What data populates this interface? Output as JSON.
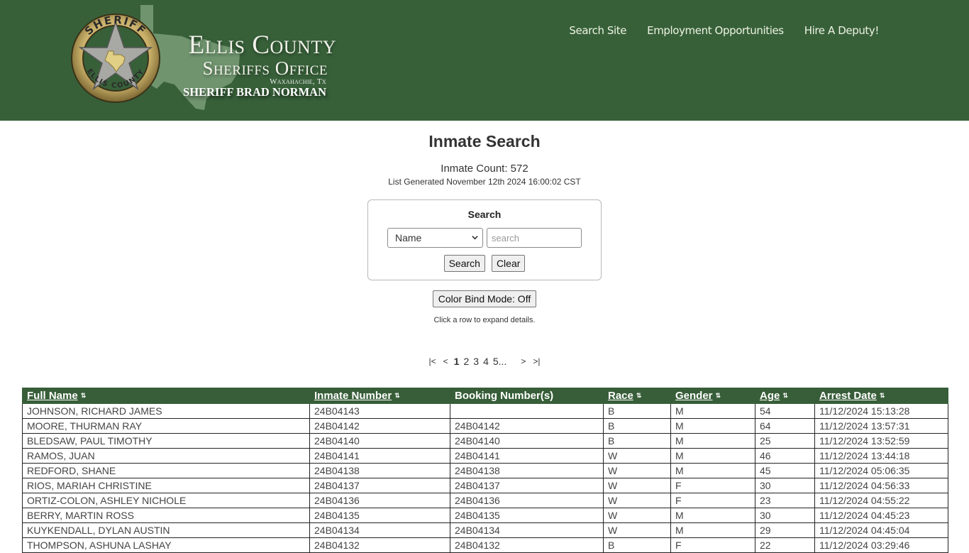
{
  "header": {
    "logo": {
      "badge_top_text": "SHERIFF",
      "badge_bottom_text": "ELLIS COUNTY",
      "line1": "Ellis County",
      "line2": "Sheriffs Office",
      "line3": "Waxahachie, Tx",
      "line4": "SHERIFF BRAD NORMAN"
    },
    "nav": [
      {
        "label": "Search Site"
      },
      {
        "label": "Employment Opportunities"
      },
      {
        "label": "Hire A Deputy!"
      }
    ],
    "colors": {
      "background": "#376039",
      "table_header": "#375e38"
    }
  },
  "main": {
    "title": "Inmate Search",
    "count_text": "Inmate Count: 572",
    "generated_text": "List Generated November 12th 2024 16:00:02 CST",
    "search": {
      "title": "Search",
      "field_selected": "Name",
      "input_value": "",
      "input_placeholder": "search",
      "search_button": "Search",
      "clear_button": "Clear"
    },
    "color_bind_button": "Color Bind Mode: Off",
    "hint": "Click a row to expand details.",
    "pager": {
      "first": "|<",
      "prev": "<",
      "pages": [
        "1",
        "2",
        "3",
        "4",
        "5..."
      ],
      "current": "1",
      "next": ">",
      "last": ">|"
    }
  },
  "table": {
    "columns": [
      {
        "label": "Full Name",
        "sortable": true
      },
      {
        "label": "Inmate Number",
        "sortable": true
      },
      {
        "label": "Booking Number(s)",
        "sortable": false
      },
      {
        "label": "Race",
        "sortable": true
      },
      {
        "label": "Gender",
        "sortable": true
      },
      {
        "label": "Age",
        "sortable": true
      },
      {
        "label": "Arrest Date",
        "sortable": true
      }
    ],
    "sort_icon": "⇅",
    "rows": [
      [
        "JOHNSON, RICHARD JAMES",
        "24B04143",
        "",
        "B",
        "M",
        "54",
        "11/12/2024 15:13:28"
      ],
      [
        "MOORE, THURMAN RAY",
        "24B04142",
        "24B04142",
        "B",
        "M",
        "64",
        "11/12/2024 13:57:31"
      ],
      [
        "BLEDSAW, PAUL TIMOTHY",
        "24B04140",
        "24B04140",
        "B",
        "M",
        "25",
        "11/12/2024 13:52:59"
      ],
      [
        "RAMOS, JUAN",
        "24B04141",
        "24B04141",
        "W",
        "M",
        "46",
        "11/12/2024 13:44:18"
      ],
      [
        "REDFORD, SHANE",
        "24B04138",
        "24B04138",
        "W",
        "M",
        "45",
        "11/12/2024 05:06:35"
      ],
      [
        "RIOS, MARIAH CHRISTINE",
        "24B04137",
        "24B04137",
        "W",
        "F",
        "30",
        "11/12/2024 04:56:33"
      ],
      [
        "ORTIZ-COLON, ASHLEY NICHOLE",
        "24B04136",
        "24B04136",
        "W",
        "F",
        "23",
        "11/12/2024 04:55:22"
      ],
      [
        "BERRY, MARTIN ROSS",
        "24B04135",
        "24B04135",
        "W",
        "M",
        "30",
        "11/12/2024 04:45:23"
      ],
      [
        "KUYKENDALL, DYLAN AUSTIN",
        "24B04134",
        "24B04134",
        "W",
        "M",
        "29",
        "11/12/2024 04:45:04"
      ],
      [
        "THOMPSON, ASHUNA LASHAY",
        "24B04132",
        "24B04132",
        "B",
        "F",
        "22",
        "11/12/2024 03:29:46"
      ]
    ]
  }
}
